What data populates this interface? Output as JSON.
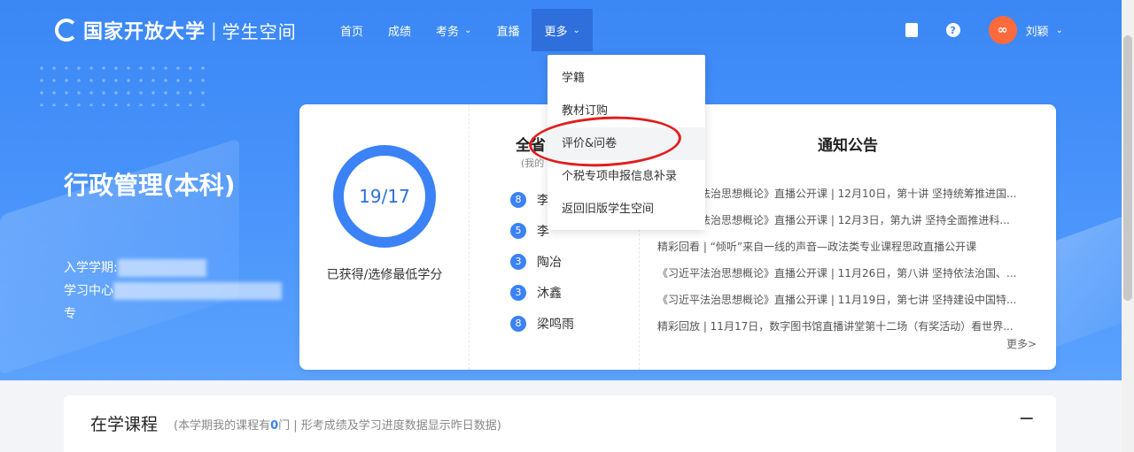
{
  "header": {
    "logo_title": "国家开放大学",
    "logo_separator": "|",
    "logo_subtitle": "学生空间",
    "nav": [
      {
        "label": "首页",
        "has_caret": false
      },
      {
        "label": "成绩",
        "has_caret": false
      },
      {
        "label": "考务",
        "has_caret": true
      },
      {
        "label": "直播",
        "has_caret": false
      },
      {
        "label": "更多",
        "has_caret": true,
        "active": true
      }
    ],
    "help_glyph": "?",
    "avatar_glyph": "∞",
    "username": "刘颖"
  },
  "profile": {
    "major": "行政管理(本科)",
    "enroll_label": "入学学期:",
    "center_label": "学习中心",
    "third_label": "专"
  },
  "credit": {
    "value": "19/17",
    "label": "已获得/选修最低学分"
  },
  "ranking": {
    "title": "全省",
    "subtitle": "(我的",
    "items": [
      {
        "num": "8",
        "name": "李"
      },
      {
        "num": "5",
        "name": "李"
      },
      {
        "num": "3",
        "name": "陶冶"
      },
      {
        "num": "3",
        "name": "沐鑫"
      },
      {
        "num": "8",
        "name": "梁鸣雨"
      }
    ]
  },
  "notice": {
    "title": "通知公告",
    "items": [
      "《习近平法治思想概论》直播公开课 | 12月10日，第十讲 坚持统筹推进国...",
      "《习近平法治思想概论》直播公开课 | 12月3日，第九讲 坚持全面推进科...",
      "精彩回看 | “倾听”来自一线的声音—政法类专业课程思政直播公开课",
      "《习近平法治思想概论》直播公开课 | 11月26日，第八讲 坚持依法治国、...",
      "《习近平法治思想概论》直播公开课 | 11月19日，第七讲 坚持建设中国特...",
      "精彩回放 | 11月17日，数字图书馆直播讲堂第十二场（有奖活动）看世界..."
    ],
    "more": "更多>"
  },
  "dropdown": {
    "items": [
      "学籍",
      "教材订购",
      "评价&问卷",
      "个税专项申报信息补录",
      "返回旧版学生空间"
    ],
    "hover_index": 2
  },
  "courses": {
    "title": "在学课程",
    "desc_prefix": "(本学期我的课程有",
    "count": "0",
    "desc_suffix": "门 | 形考成绩及学习进度数据显示昨日数据)",
    "collapse": "−"
  },
  "colors": {
    "primary": "#3b82f6",
    "hero_bg": "#3a87f5",
    "nav_active": "#2f6fdc",
    "highlight": "#e11d1d",
    "avatar": "#ff6a3d"
  }
}
